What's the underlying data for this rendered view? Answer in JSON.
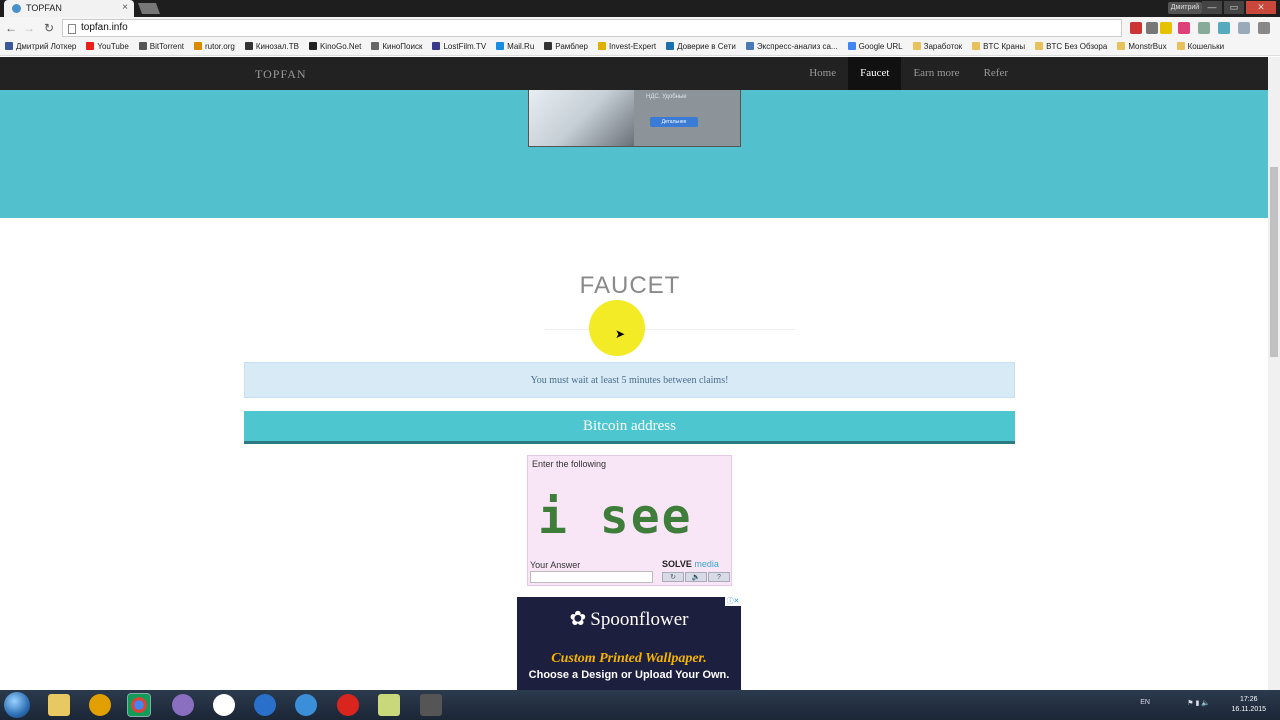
{
  "browser": {
    "tab_title": "TOPFAN",
    "tab_close": "×",
    "url": "topfan.info",
    "user": "Дмитрий",
    "nav": {
      "back": "←",
      "forward": "→",
      "reload": "↻"
    },
    "win_buttons": [
      "—",
      "▭",
      "✕"
    ]
  },
  "bookmarks": [
    {
      "label": "Дмитрий Лоткер",
      "color": "#3b5998"
    },
    {
      "label": "YouTube",
      "color": "#e62117"
    },
    {
      "label": "BitTorrent",
      "color": "#555555"
    },
    {
      "label": "rutor.org",
      "color": "#d98a00"
    },
    {
      "label": "Кинозал.ТВ",
      "color": "#333333"
    },
    {
      "label": "KinoGo.Net",
      "color": "#222222"
    },
    {
      "label": "КиноПоиск",
      "color": "#666666"
    },
    {
      "label": "LostFilm.TV",
      "color": "#3a3a8a"
    },
    {
      "label": "Mail.Ru",
      "color": "#168de2"
    },
    {
      "label": "Рамблер",
      "color": "#333333"
    },
    {
      "label": "Invest-Expert",
      "color": "#e0b000"
    },
    {
      "label": "Доверие в Сети",
      "color": "#1a6fb0"
    },
    {
      "label": "Экспресс-анализ са...",
      "color": "#4a7ab5"
    },
    {
      "label": "Google URL",
      "color": "#4285f4"
    },
    {
      "label": "Заработок",
      "color": "#e8c15a"
    },
    {
      "label": "BTC Краны",
      "color": "#e8c15a"
    },
    {
      "label": "BTC Без Обзора",
      "color": "#e8c15a"
    },
    {
      "label": "MonstrBux",
      "color": "#e8c15a"
    },
    {
      "label": "Кошельки",
      "color": "#e8c15a"
    }
  ],
  "site": {
    "brand": "TOPFAN",
    "nav": [
      "Home",
      "Faucet",
      "Earn more",
      "Refer"
    ],
    "active_nav": "Faucet",
    "hero_ad": {
      "caption": "НДС. Удобные",
      "button": "Детальнее"
    },
    "title": "FAUCET",
    "alert": "You must wait at least 5 minutes between claims!",
    "address_label": "Bitcoin address",
    "captcha": {
      "header": "Enter the following",
      "challenge": "i see",
      "answer_label": "Your Answer",
      "brand": "SOLVE",
      "brand_suffix": "media",
      "buttons": [
        "↻",
        "🔈",
        "?"
      ]
    },
    "bottom_ad": {
      "logo": "Spoonflower",
      "headline": "Custom Printed Wallpaper.",
      "subline": "Choose a Design or Upload Your Own.",
      "close": "ⓘ✕"
    }
  },
  "taskbar": {
    "lang": "EN",
    "time": "17:26",
    "date": "16.11.2015"
  }
}
